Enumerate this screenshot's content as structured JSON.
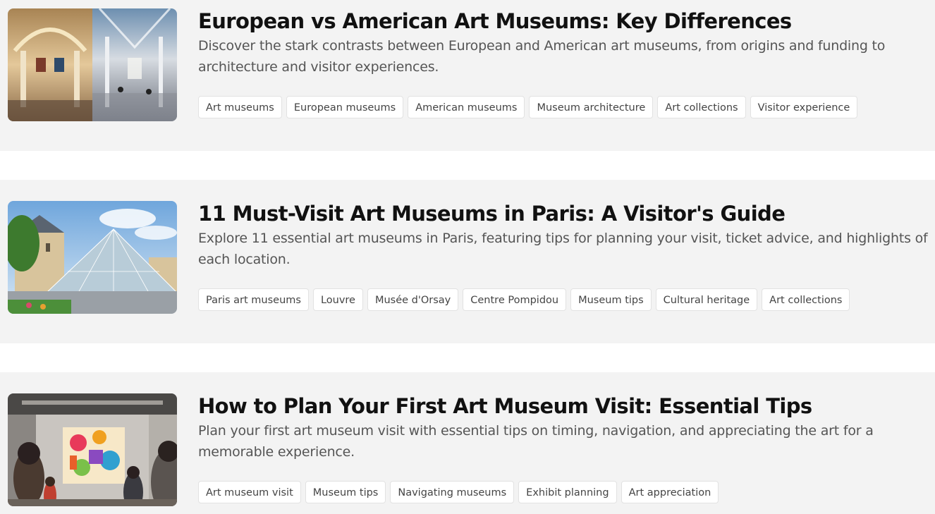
{
  "articles": [
    {
      "title": "European vs American Art Museums: Key Differences",
      "description": "Discover the stark contrasts between European and American art museums, from origins and funding to architecture and visitor experiences.",
      "tags": [
        "Art museums",
        "European museums",
        "American museums",
        "Museum architecture",
        "Art collections",
        "Visitor experience"
      ]
    },
    {
      "title": "11 Must-Visit Art Museums in Paris: A Visitor's Guide",
      "description": "Explore 11 essential art museums in Paris, featuring tips for planning your visit, ticket advice, and highlights of each location.",
      "tags": [
        "Paris art museums",
        "Louvre",
        "Musée d'Orsay",
        "Centre Pompidou",
        "Museum tips",
        "Cultural heritage",
        "Art collections"
      ]
    },
    {
      "title": "How to Plan Your First Art Museum Visit: Essential Tips",
      "description": "Plan your first art museum visit with essential tips on timing, navigation, and appreciating the art for a memorable experience.",
      "tags": [
        "Art museum visit",
        "Museum tips",
        "Navigating museums",
        "Exhibit planning",
        "Art appreciation"
      ]
    }
  ]
}
